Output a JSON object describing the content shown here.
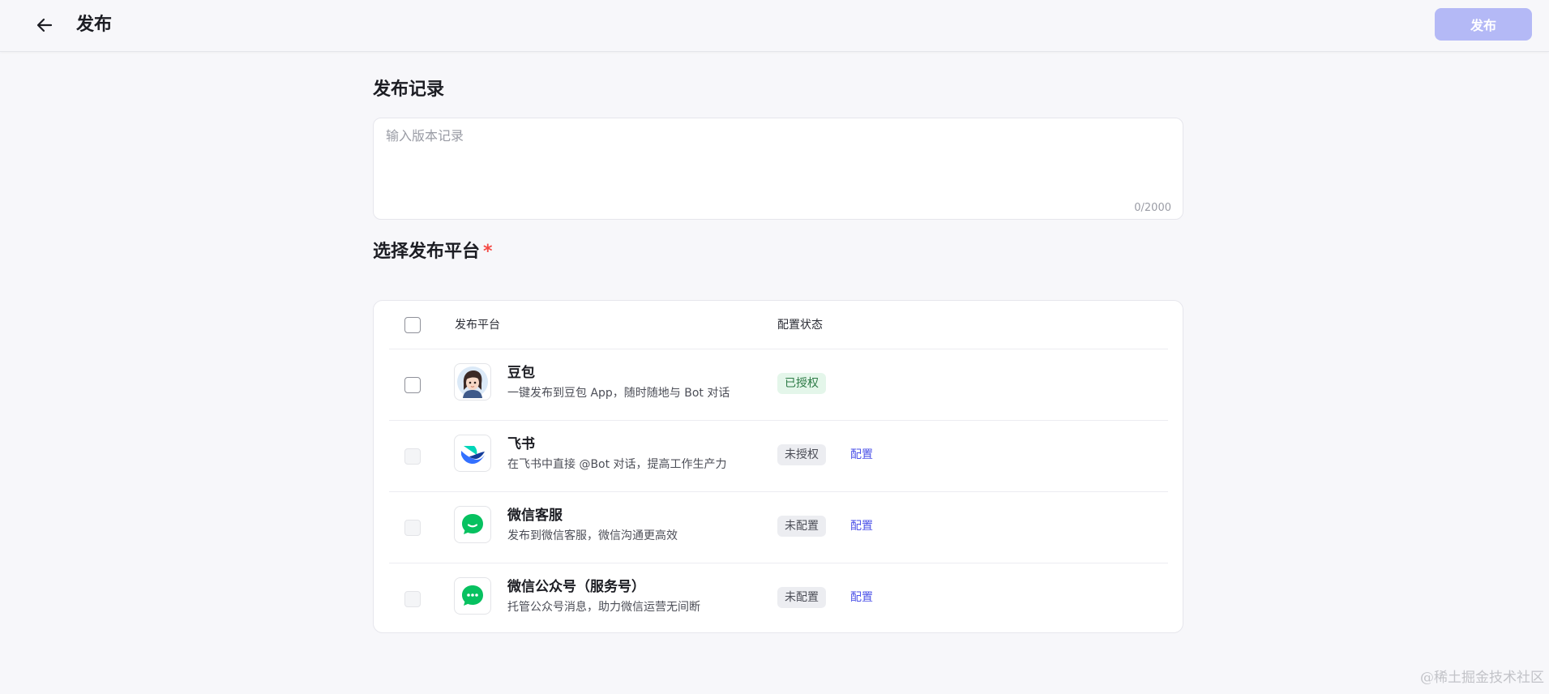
{
  "header": {
    "title": "发布",
    "publish_label": "发布"
  },
  "record": {
    "title": "发布记录",
    "placeholder": "输入版本记录",
    "counter": "0/2000"
  },
  "platforms": {
    "title": "选择发布平台",
    "required_mark": "*",
    "columns": {
      "platform": "发布平台",
      "status": "配置状态"
    },
    "items": [
      {
        "name": "豆包",
        "desc": "一键发布到豆包 App，随时随地与 Bot 对话",
        "status": "已授权",
        "status_kind": "ok",
        "checkbox_enabled": true,
        "icon": "doubao-avatar-icon"
      },
      {
        "name": "飞书",
        "desc": "在飞书中直接 @Bot 对话，提高工作生产力",
        "status": "未授权",
        "status_kind": "no",
        "config": "配置",
        "checkbox_enabled": false,
        "icon": "feishu-icon"
      },
      {
        "name": "微信客服",
        "desc": "发布到微信客服，微信沟通更高效",
        "status": "未配置",
        "status_kind": "no",
        "config": "配置",
        "checkbox_enabled": false,
        "icon": "wechat-service-icon"
      },
      {
        "name": "微信公众号（服务号）",
        "desc": "托管公众号消息，助力微信运营无间断",
        "status": "未配置",
        "status_kind": "no",
        "config": "配置",
        "checkbox_enabled": false,
        "icon": "wechat-official-account-icon"
      }
    ]
  },
  "watermark": "@稀土掘金技术社区",
  "colors": {
    "accent": "#4d53e8",
    "publish_disabled": "#b4b9f6",
    "wechat_green": "#07c160",
    "required": "#f54a45"
  }
}
